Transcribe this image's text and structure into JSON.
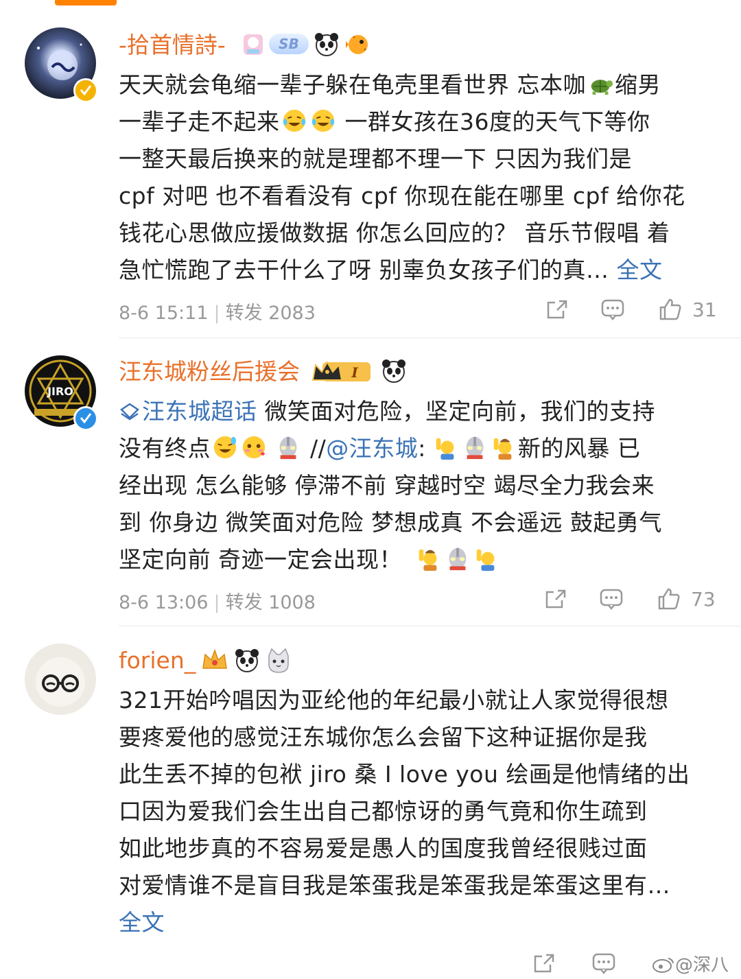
{
  "posts": [
    {
      "username": "-拾首情詩-",
      "badge_text": "SB",
      "lines": [
        "天天就会龟缩一辈子躲在龟壳里看世界 忘本咖",
        "缩男",
        "一辈子走不起来",
        "一群女孩在36度的天气下等你",
        "一整天最后换来的就是理都不理一下 只因为我们是",
        "cpf 对吧 也不看看没有 cpf 你现在能在哪里 cpf 给你花",
        "钱花心思做应援做数据 你怎么回应的？ 音乐节假唱 着",
        "急忙慌跑了去干什么了呀 别辜负女孩子们的真…"
      ],
      "full_text_link": "全文",
      "time": "8-6 15:11",
      "repost": "转发 2083",
      "likes": "31"
    },
    {
      "username": "汪东城粉丝后援会",
      "badge_text": "I",
      "avatar_text": "JIRO",
      "topic": "汪东城超话",
      "lines": [
        "微笑面对危险，坚定向前，我们的支持",
        "没有终点",
        "//",
        "@汪东城",
        ":",
        "新的风暴 已",
        "经出现 怎么能够 停滞不前 穿越时空 竭尽全力我会来",
        "到 你身边 微笑面对危险 梦想成真 不会遥远 鼓起勇气",
        "坚定向前 奇迹一定会出现！"
      ],
      "time": "8-6 13:06",
      "repost": "转发 1008",
      "likes": "73"
    },
    {
      "username": "forien_",
      "lines": [
        "321开始吟唱因为亚纶他的年纪最小就让人家觉得很想",
        "要疼爱他的感觉汪东城你怎么会留下这种证据你是我",
        "此生丢不掉的包袱 jiro 桑 I love you 绘画是他情绪的出",
        "口因为爱我们会生出自己都惊讶的勇气竟和你生疏到",
        "如此地步真的不容易爱是愚人的国度我曾经很贱过面",
        "对爱情谁不是盲目我是笨蛋我是笨蛋我是笨蛋这里有…"
      ],
      "full_text_link": "全文"
    }
  ],
  "watermark": "@深八",
  "colors": {
    "accent": "#ff8200",
    "username": "#e8702a",
    "link": "#3b73b6",
    "meta": "#999999"
  },
  "icons": [
    "share-icon",
    "comment-icon",
    "like-icon",
    "verified-icon",
    "panda-icon",
    "turtle-icon",
    "laugh-cry-icon",
    "ultraman-icon",
    "raise-hand-icon",
    "cat-icon",
    "crown-icon"
  ]
}
